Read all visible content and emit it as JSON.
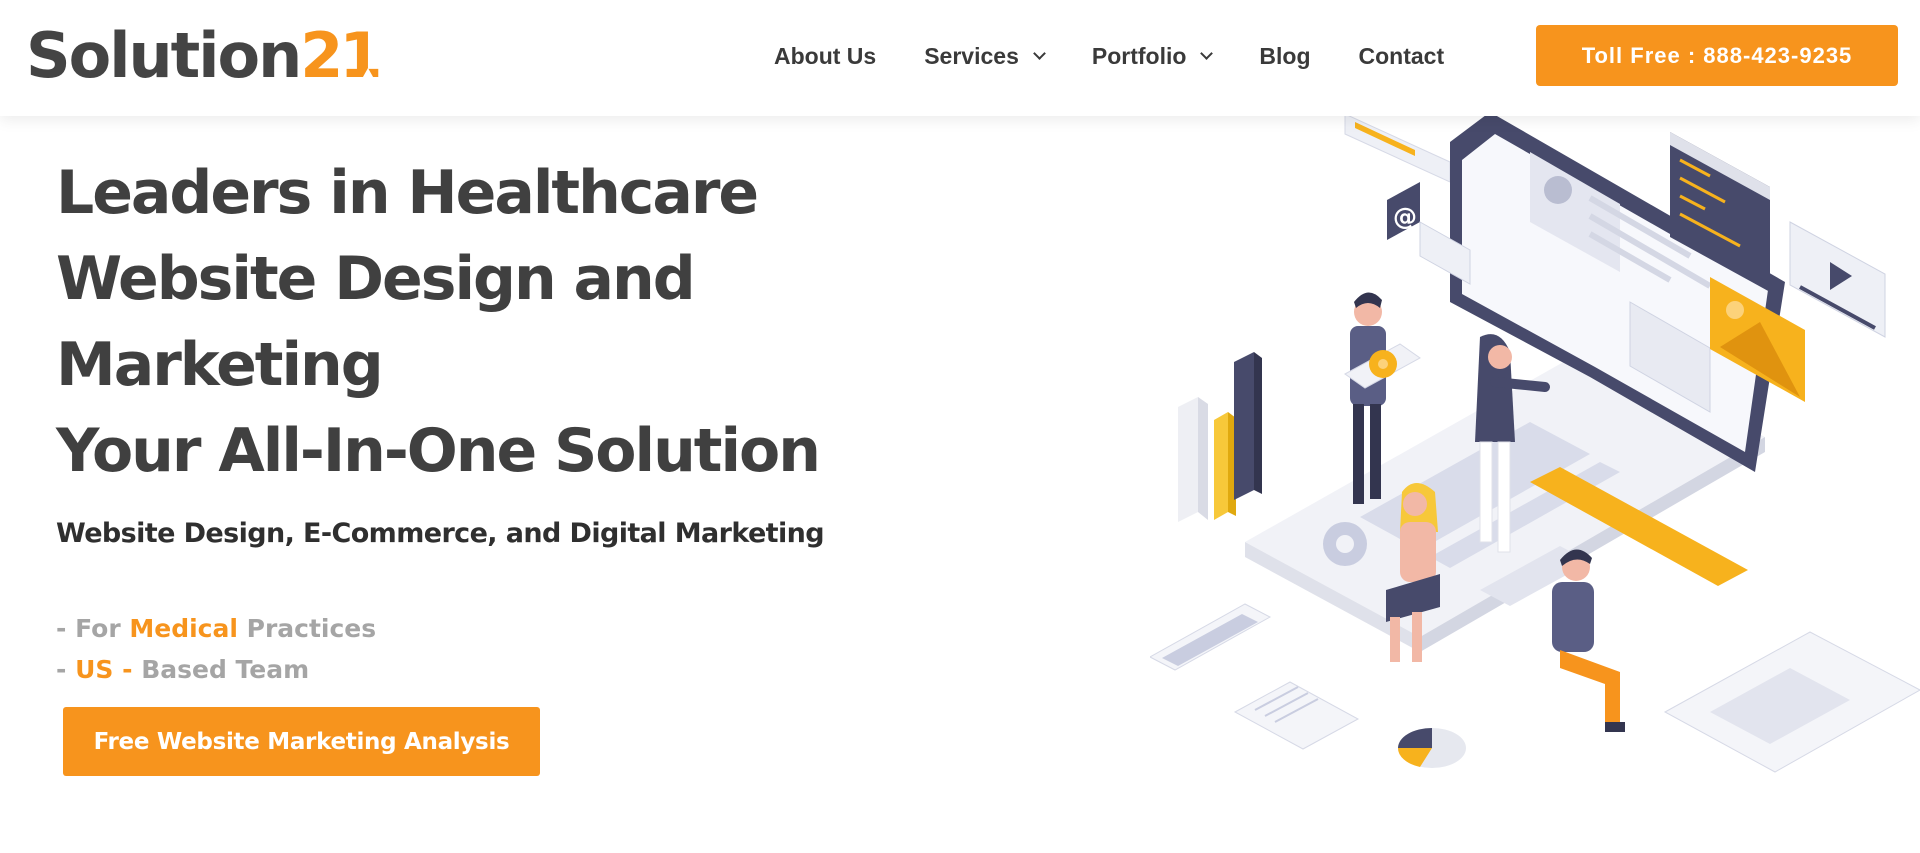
{
  "header": {
    "logo": {
      "text": "Solution",
      "number": "21"
    },
    "nav": [
      {
        "label": "About Us",
        "has_dropdown": false
      },
      {
        "label": "Services",
        "has_dropdown": true
      },
      {
        "label": "Portfolio",
        "has_dropdown": true
      },
      {
        "label": "Blog",
        "has_dropdown": false
      },
      {
        "label": "Contact",
        "has_dropdown": false
      }
    ],
    "cta_label": "Toll Free : 888-423-9235"
  },
  "hero": {
    "title_lines": [
      "Leaders in Healthcare",
      "Website Design and",
      "Marketing",
      "Your All-In-One Solution"
    ],
    "subtitle": "Website Design, E-Commerce, and Digital Marketing",
    "bullet1": {
      "prefix": "- For ",
      "highlight": "Medical",
      "suffix": " Practices"
    },
    "bullet2": {
      "prefix": "- ",
      "highlight": "US -",
      "suffix": " Based Team"
    },
    "cta_label": "Free Website Marketing Analysis"
  },
  "colors": {
    "accent": "#f7941d",
    "heading": "#404040",
    "muted": "#a5a5a5",
    "navy": "#474a6b"
  },
  "icons": [
    "chevron-down-icon",
    "at-sign-icon",
    "user-icon",
    "play-icon",
    "gear-icon",
    "image-icon"
  ]
}
